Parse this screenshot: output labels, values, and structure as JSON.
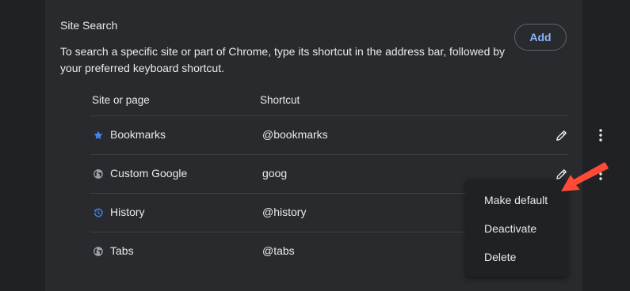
{
  "section": {
    "title": "Site Search",
    "description": "To search a specific site or part of Chrome, type its shortcut in the address bar, followed by your preferred keyboard shortcut.",
    "add_label": "Add"
  },
  "table": {
    "headers": {
      "site": "Site or page",
      "shortcut": "Shortcut"
    },
    "rows": [
      {
        "name": "Bookmarks",
        "shortcut": "@bookmarks",
        "icon": "star-icon"
      },
      {
        "name": "Custom Google",
        "shortcut": "goog",
        "icon": "globe-icon"
      },
      {
        "name": "History",
        "shortcut": "@history",
        "icon": "history-icon"
      },
      {
        "name": "Tabs",
        "shortcut": "@tabs",
        "icon": "globe-icon"
      }
    ]
  },
  "context_menu": {
    "items": [
      "Make default",
      "Deactivate",
      "Delete"
    ]
  },
  "colors": {
    "page_background": "#202124",
    "card_background": "#292a2d",
    "accent_blue": "#8ab4f8",
    "icon_blue": "#4285f4",
    "arrow_red": "#ff4b36"
  }
}
